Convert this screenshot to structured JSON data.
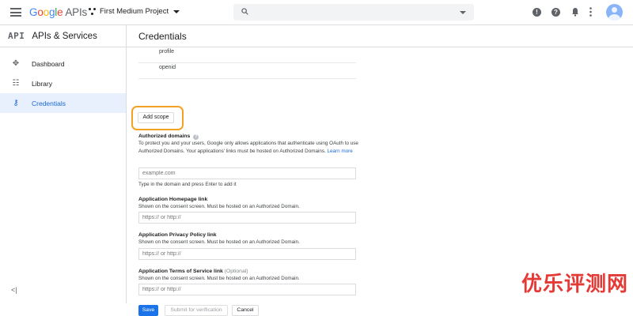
{
  "topbar": {
    "logo_letters": [
      "G",
      "o",
      "o",
      "g",
      "l",
      "e"
    ],
    "logo_suffix": "APIs",
    "project_name": "First Medium Project",
    "search_placeholder": ""
  },
  "sidebar": {
    "badge": "API",
    "title": "APIs & Services",
    "items": [
      {
        "label": "Dashboard",
        "icon": "dashboard-icon"
      },
      {
        "label": "Library",
        "icon": "library-icon"
      },
      {
        "label": "Credentials",
        "icon": "key-icon",
        "active": true
      }
    ],
    "collapse_label": "<|"
  },
  "main": {
    "page_title": "Credentials",
    "scopes": [
      "profile",
      "openid"
    ],
    "add_scope_label": "Add scope",
    "authorized_domains": {
      "label": "Authorized domains",
      "help": "?",
      "description": "To protect you and your users, Google only allows applications that authenticate using OAuth to use Authorized Domains. Your applications' links must be hosted on Authorized Domains.",
      "learn_more": "Learn more",
      "placeholder": "example.com",
      "hint": "Type in the domain and press Enter to add it"
    },
    "homepage": {
      "label": "Application Homepage link",
      "description": "Shown on the consent screen. Must be hosted on an Authorized Domain.",
      "placeholder": "https:// or http://"
    },
    "privacy": {
      "label": "Application Privacy Policy link",
      "description": "Shown on the consent screen. Must be hosted on an Authorized Domain.",
      "placeholder": "https:// or http://"
    },
    "terms": {
      "label": "Application Terms of Service link",
      "optional": "(Optional)",
      "description": "Shown on the consent screen. Must be hosted on an Authorized Domain.",
      "placeholder": "https:// or http://"
    },
    "buttons": {
      "save": "Save",
      "submit": "Submit for verification",
      "cancel": "Cancel"
    }
  },
  "watermark": "优乐评测网"
}
